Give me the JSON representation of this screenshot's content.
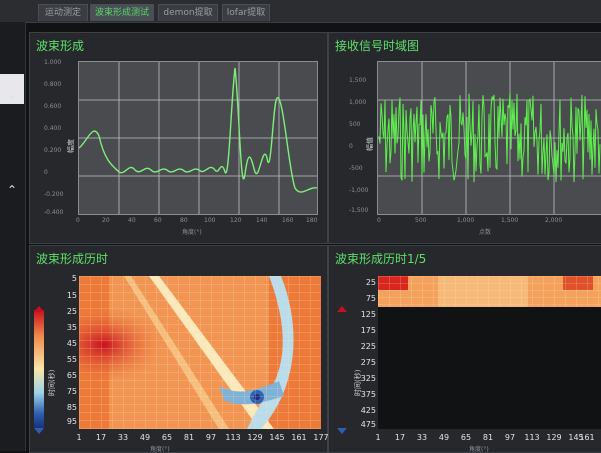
{
  "tabs": [
    {
      "label": "运动测定",
      "active": false
    },
    {
      "label": "波束形成测试",
      "active": true
    },
    {
      "label": "demon提取",
      "active": false
    },
    {
      "label": "lofar提取",
      "active": false
    }
  ],
  "panels": {
    "beamforming": {
      "title": "波束形成",
      "y_ticks": [
        "1.000",
        "0.800",
        "0.600",
        "0.400",
        "0.200",
        "0",
        "-0.200",
        "-0.400"
      ],
      "x_ticks": [
        "0",
        "20",
        "40",
        "60",
        "80",
        "100",
        "120",
        "140",
        "160",
        "180"
      ],
      "xlabel": "角度(°)",
      "ylabel": "幅度"
    },
    "signal": {
      "title": "接收信号时域图",
      "y_ticks": [
        "1,500",
        "1,000",
        "500",
        "0",
        "-500",
        "-1,000",
        "-1,500"
      ],
      "x_ticks": [
        "0",
        "500",
        "1,000",
        "1,500",
        "2,000"
      ],
      "xlabel": "点数",
      "ylabel": "幅值"
    },
    "history": {
      "title": "波束形成历时",
      "y_ticks": [
        "5",
        "15",
        "25",
        "35",
        "45",
        "55",
        "65",
        "75",
        "85",
        "95"
      ],
      "x_ticks": [
        "1",
        "17",
        "33",
        "49",
        "65",
        "81",
        "97",
        "113",
        "129",
        "145",
        "161",
        "177"
      ],
      "xlabel": "角度(°)",
      "ylabel": "时间(秒)"
    },
    "history5": {
      "title": "波束形成历时1/5",
      "y_ticks": [
        "25",
        "75",
        "125",
        "175",
        "225",
        "275",
        "325",
        "375",
        "425",
        "475"
      ],
      "x_ticks": [
        "1",
        "17",
        "33",
        "49",
        "65",
        "81",
        "97",
        "113",
        "129",
        "145",
        "161"
      ],
      "xlabel": "角度(°)",
      "ylabel": "时间(秒)"
    }
  },
  "colors": {
    "accent_green": "#5ee06c",
    "plot_bg": "#4a4b4f",
    "hot": "#c8101e",
    "cold": "#1a2f80"
  },
  "icons": [
    "chevron-up-icon",
    "chevron-up-icon"
  ]
}
